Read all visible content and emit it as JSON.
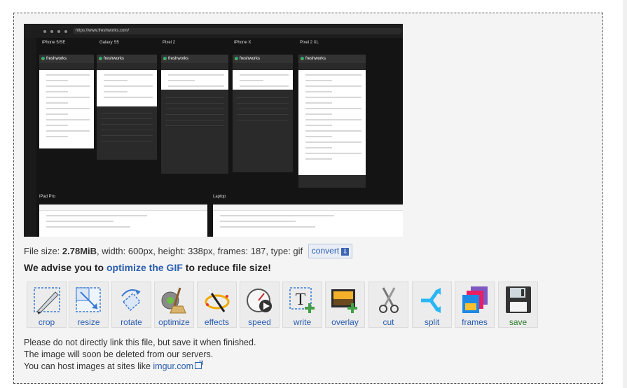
{
  "preview": {
    "url": "https://www.freshworks.com/",
    "devices": [
      "iPhone 5/SE",
      "Galaxy S5",
      "Pixel 2",
      "iPhone X",
      "Pixel 2 XL"
    ],
    "bottom_devices": [
      "iPad Pro",
      "Laptop"
    ],
    "brand": "freshworks"
  },
  "info": {
    "prefix": "File size: ",
    "size": "2.78MiB",
    "details": ", width: 600px, height: 338px, frames: 187, type: gif",
    "convert_label": "convert"
  },
  "advise": {
    "before": "We advise you to ",
    "link": "optimize the GIF",
    "after": " to reduce file size!"
  },
  "tools": [
    {
      "label": "crop",
      "icon": "crop-icon"
    },
    {
      "label": "resize",
      "icon": "resize-icon"
    },
    {
      "label": "rotate",
      "icon": "rotate-icon"
    },
    {
      "label": "optimize",
      "icon": "optimize-icon"
    },
    {
      "label": "effects",
      "icon": "effects-icon"
    },
    {
      "label": "speed",
      "icon": "speed-icon"
    },
    {
      "label": "write",
      "icon": "write-icon"
    },
    {
      "label": "overlay",
      "icon": "overlay-icon"
    },
    {
      "label": "cut",
      "icon": "cut-icon"
    },
    {
      "label": "split",
      "icon": "split-icon"
    },
    {
      "label": "frames",
      "icon": "frames-icon"
    },
    {
      "label": "save",
      "icon": "save-icon"
    }
  ],
  "notes": {
    "line1": "Please do not directly link this file, but save it when finished.",
    "line2": "The image will soon be deleted from our servers.",
    "line3_prefix": "You can host images at sites like ",
    "line3_link": "imgur.com"
  }
}
